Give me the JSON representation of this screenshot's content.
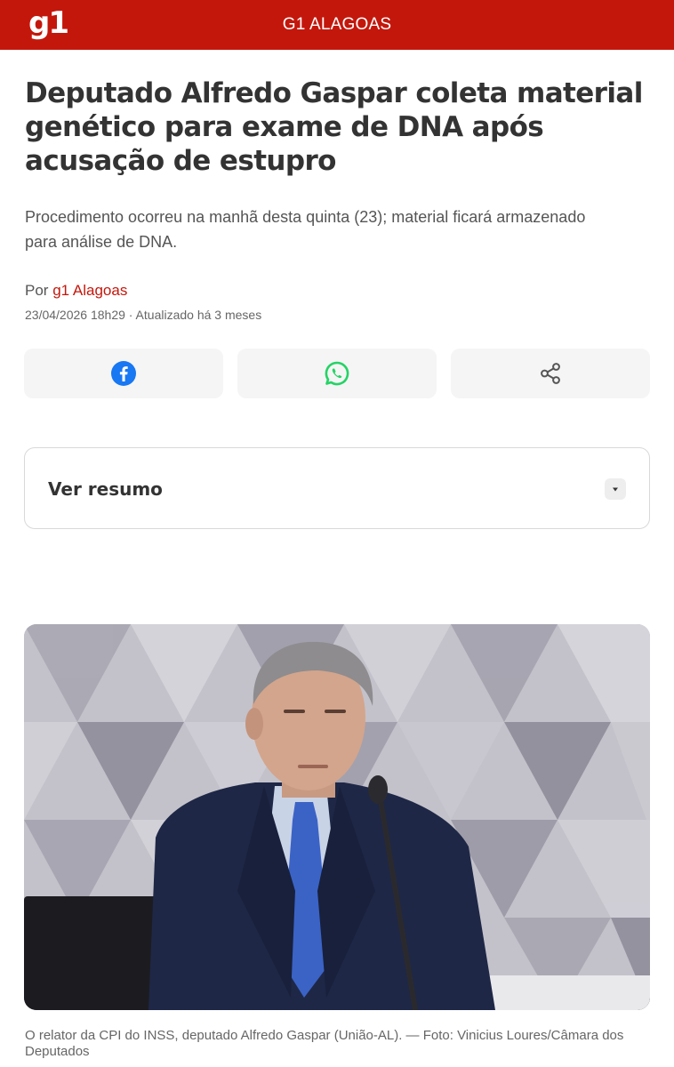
{
  "header": {
    "logo": "g1",
    "section": "G1 ALAGOAS",
    "brand_color": "#c4170c"
  },
  "article": {
    "headline": "Deputado Alfredo Gaspar coleta material genético para exame de DNA após acusação de estupro",
    "subtitle": "Procedimento ocorreu na manhã desta quinta (23); material ficará armazenado para análise de DNA.",
    "byline_prefix": "Por",
    "author": "g1 Alagoas",
    "date": "23/04/2026 18h29 · Atualizado há 3 meses"
  },
  "share": {
    "buttons": [
      {
        "icon": "facebook-icon",
        "color": "#1877f2"
      },
      {
        "icon": "whatsapp-icon",
        "color": "#25d366"
      },
      {
        "icon": "share-icon",
        "color": "#555555"
      }
    ]
  },
  "summary": {
    "label": "Ver resumo",
    "toggle_icon": "chevron-down-icon"
  },
  "photo": {
    "caption": "O relator da CPI do INSS, deputado Alfredo Gaspar (União-AL). — Foto: Vinicius Loures/Câmara dos Deputados"
  }
}
